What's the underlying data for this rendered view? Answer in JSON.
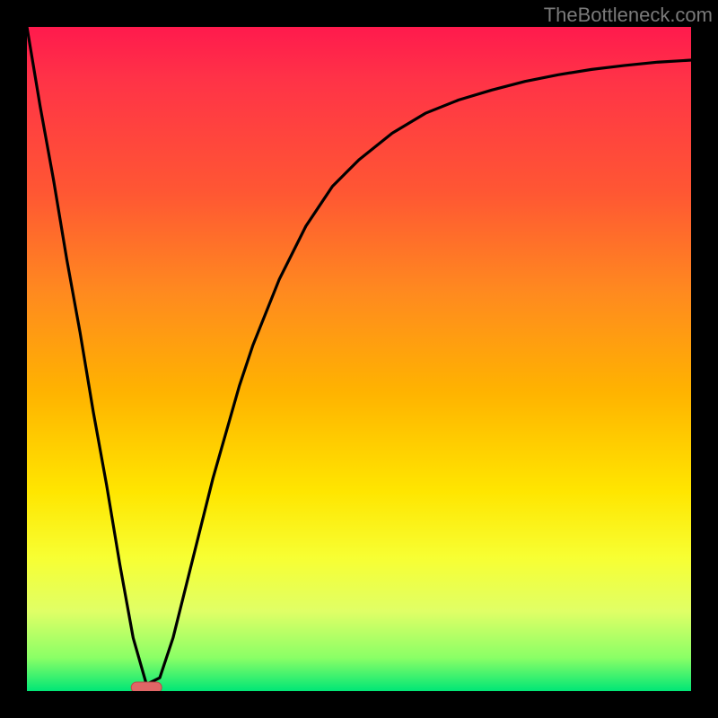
{
  "watermark": "TheBottleneck.com",
  "colors": {
    "frame": "#000000",
    "curve": "#000000",
    "marker_fill": "#e06666",
    "marker_stroke": "#b94a4a",
    "gradient_stops": [
      "#ff1a4d",
      "#ff3347",
      "#ff5733",
      "#ff8a1f",
      "#ffb300",
      "#ffe600",
      "#f7ff33",
      "#e0ff66",
      "#8aff66",
      "#00e676"
    ]
  },
  "chart_data": {
    "type": "line",
    "title": "",
    "xlabel": "",
    "ylabel": "",
    "xlim": [
      0,
      100
    ],
    "ylim": [
      0,
      100
    ],
    "x": [
      0,
      2,
      4,
      6,
      8,
      10,
      12,
      14,
      16,
      18,
      20,
      22,
      24,
      26,
      28,
      30,
      32,
      34,
      36,
      38,
      40,
      42,
      44,
      46,
      48,
      50,
      55,
      60,
      65,
      70,
      75,
      80,
      85,
      90,
      95,
      100
    ],
    "values": [
      100,
      88,
      77,
      65,
      54,
      42,
      31,
      19,
      8,
      1,
      2,
      8,
      16,
      24,
      32,
      39,
      46,
      52,
      57,
      62,
      66,
      70,
      73,
      76,
      78,
      80,
      84,
      87,
      89,
      90.5,
      91.8,
      92.8,
      93.6,
      94.2,
      94.7,
      95
    ],
    "minimum_marker": {
      "x": 18,
      "y": 0
    },
    "grid": false,
    "legend": null
  }
}
